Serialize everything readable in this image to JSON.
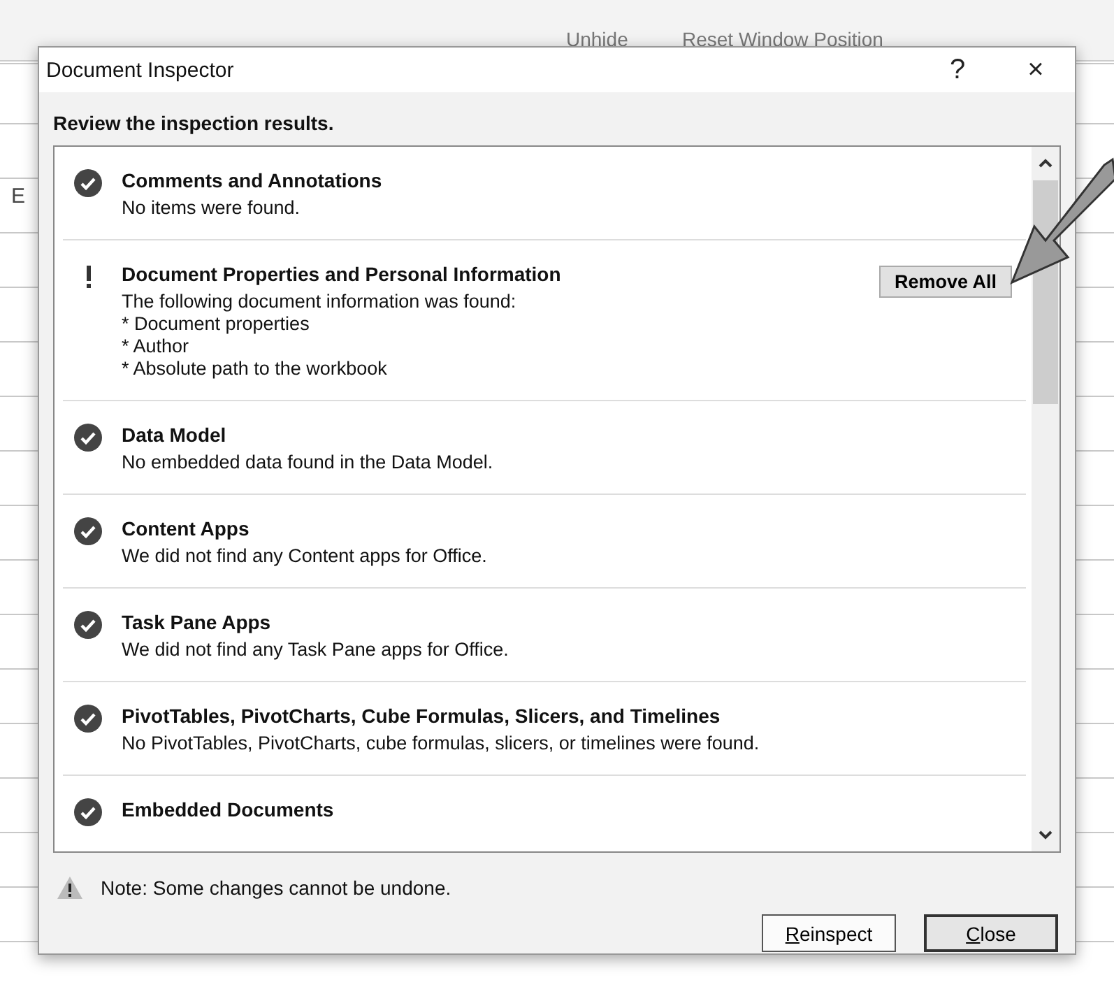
{
  "background": {
    "ribbon": [
      "Unhide",
      "Reset Window Position"
    ],
    "column_header": "E"
  },
  "dialog": {
    "title": "Document Inspector",
    "help": "?",
    "close": "×",
    "intro": "Review the inspection results.",
    "results": [
      {
        "kind": "ok",
        "title": "Comments and Annotations",
        "lines": [
          "No items were found."
        ]
      },
      {
        "kind": "warning",
        "title": "Document Properties and Personal Information",
        "lines": [
          "The following document information was found:",
          "* Document properties",
          "* Author",
          "* Absolute path to the workbook"
        ],
        "action": "Remove All"
      },
      {
        "kind": "ok",
        "title": "Data Model",
        "lines": [
          "No embedded data found in the Data Model."
        ]
      },
      {
        "kind": "ok",
        "title": "Content Apps",
        "lines": [
          "We did not find any Content apps for Office."
        ]
      },
      {
        "kind": "ok",
        "title": "Task Pane Apps",
        "lines": [
          "We did not find any Task Pane apps for Office."
        ]
      },
      {
        "kind": "ok",
        "title": "PivotTables, PivotCharts, Cube Formulas, Slicers, and Timelines",
        "lines": [
          "No PivotTables, PivotCharts, cube formulas, slicers, or timelines were found."
        ]
      },
      {
        "kind": "ok",
        "title": "Embedded Documents"
      }
    ],
    "note": "Note: Some changes cannot be undone.",
    "buttons": [
      {
        "access_key": "R",
        "rest": "einspect",
        "default": false
      },
      {
        "access_key": "C",
        "rest": "lose",
        "default": true
      }
    ]
  }
}
